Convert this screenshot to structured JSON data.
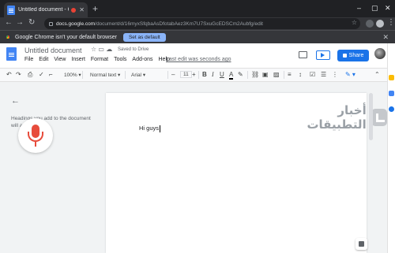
{
  "browser": {
    "tab_title": "Untitled document - Google Docs",
    "new_tab_symbol": "+",
    "url_host": "docs.google.com",
    "url_path": "/document/d/16myxSfqbaAsDfotabAez3Km7U7SxuGcEDSCm2Aubfg/edit",
    "info_text": "Google Chrome isn't your default browser",
    "info_button": "Set as default"
  },
  "docs": {
    "title": "Untitled document",
    "saved_status": "Saved to Drive",
    "menu": [
      "File",
      "Edit",
      "View",
      "Insert",
      "Format",
      "Tools",
      "Add-ons",
      "Help"
    ],
    "last_edit": "Last edit was seconds ago",
    "share_label": "Share"
  },
  "toolbar": {
    "zoom": "100%",
    "style": "Normal text",
    "font": "Arial",
    "font_size": "11",
    "minus": "–",
    "plus": "+"
  },
  "outline": {
    "hint": "Headings you add to the document will appear here."
  },
  "document": {
    "body_text": "Hi guys"
  },
  "watermark": {
    "text": "أخبار التطبيقات"
  },
  "colors": {
    "accent": "#1a73e8",
    "mic": "#e74c3c",
    "chrome_dark": "#202124"
  }
}
